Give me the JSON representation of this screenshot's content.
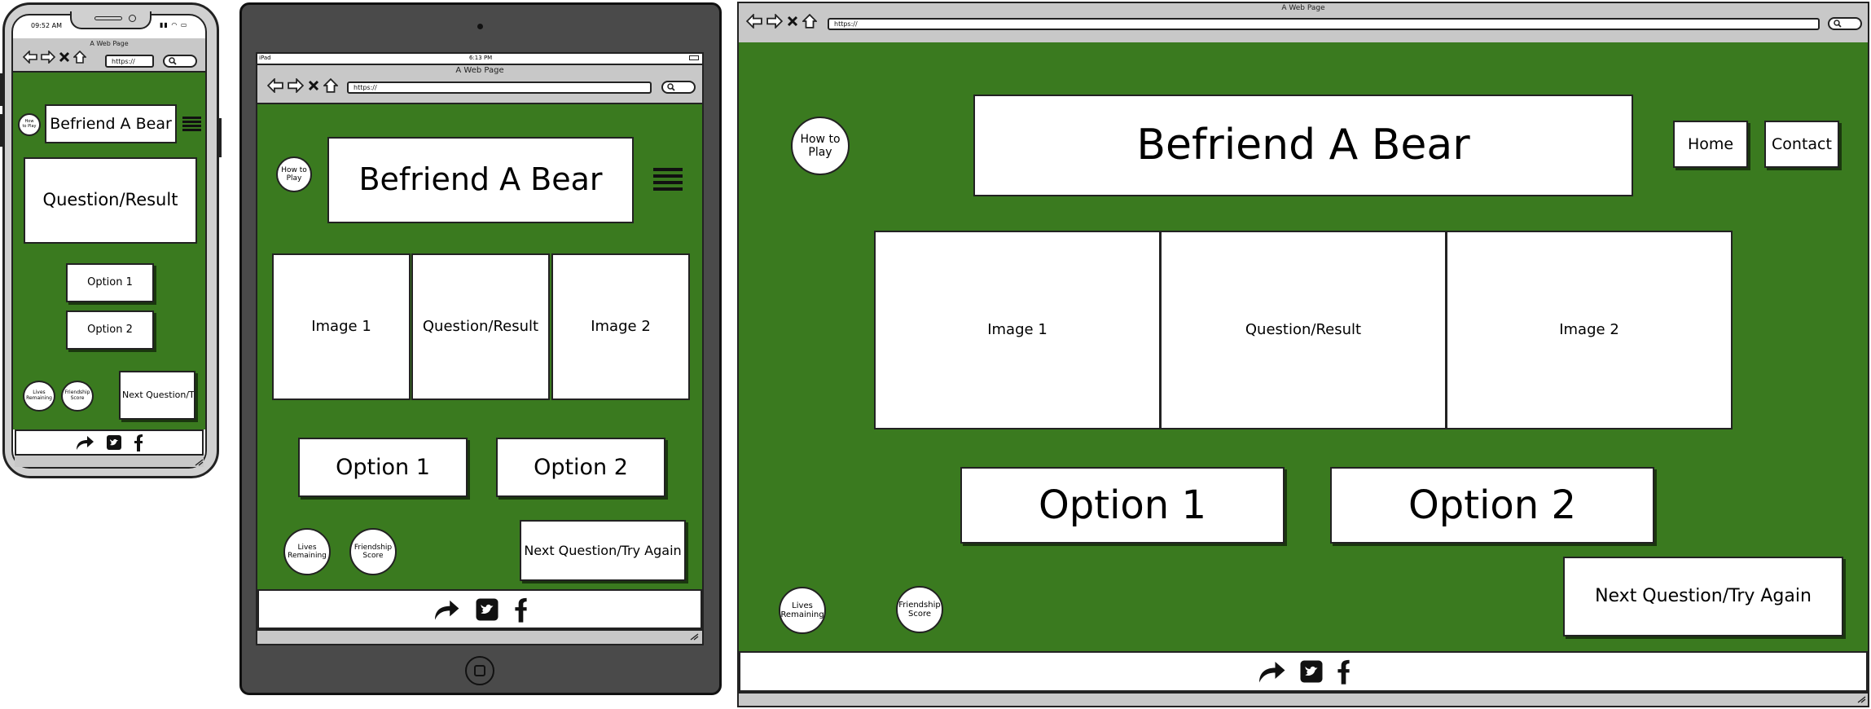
{
  "app": {
    "title": "Befriend A Bear",
    "browser_title": "A Web Page",
    "url": "https://"
  },
  "phone": {
    "time": "09:52 AM",
    "how_to_play": "How\nto Play",
    "main": "Question/Result",
    "option1": "Option 1",
    "option2": "Option 2",
    "lives": "Lives\nRemaining",
    "friendship": "Friendship\nScore",
    "next": "Next Question/Try"
  },
  "tablet": {
    "status_left": "iPad",
    "time": "6:13 PM",
    "how_to_play": "How to\nPlay",
    "image1": "Image 1",
    "main": "Question/Result",
    "image2": "Image 2",
    "option1": "Option 1",
    "option2": "Option 2",
    "lives": "Lives\nRemaining",
    "friendship": "Friendship\nScore",
    "next": "Next Question/Try Again"
  },
  "desktop": {
    "how_to_play": "How to\nPlay",
    "nav_home": "Home",
    "nav_contact": "Contact",
    "image1": "Image 1",
    "main": "Question/Result",
    "image2": "Image 2",
    "option1": "Option 1",
    "option2": "Option 2",
    "lives": "Lives\nRemaining",
    "friendship": "Friendship\nScore",
    "next": "Next Question/Try Again"
  },
  "icons": {
    "back": "back-arrow-icon",
    "forward": "forward-arrow-icon",
    "stop": "close-icon",
    "home": "home-icon",
    "search": "search-icon",
    "share": "share-arrow-icon",
    "twitter": "twitter-icon",
    "facebook": "facebook-icon",
    "menu": "hamburger-menu-icon",
    "resize": "resize-grip-icon"
  },
  "colors": {
    "background": "#3a7a1f",
    "device_dark": "#4a4a4a",
    "chrome": "#c8c8c8"
  }
}
